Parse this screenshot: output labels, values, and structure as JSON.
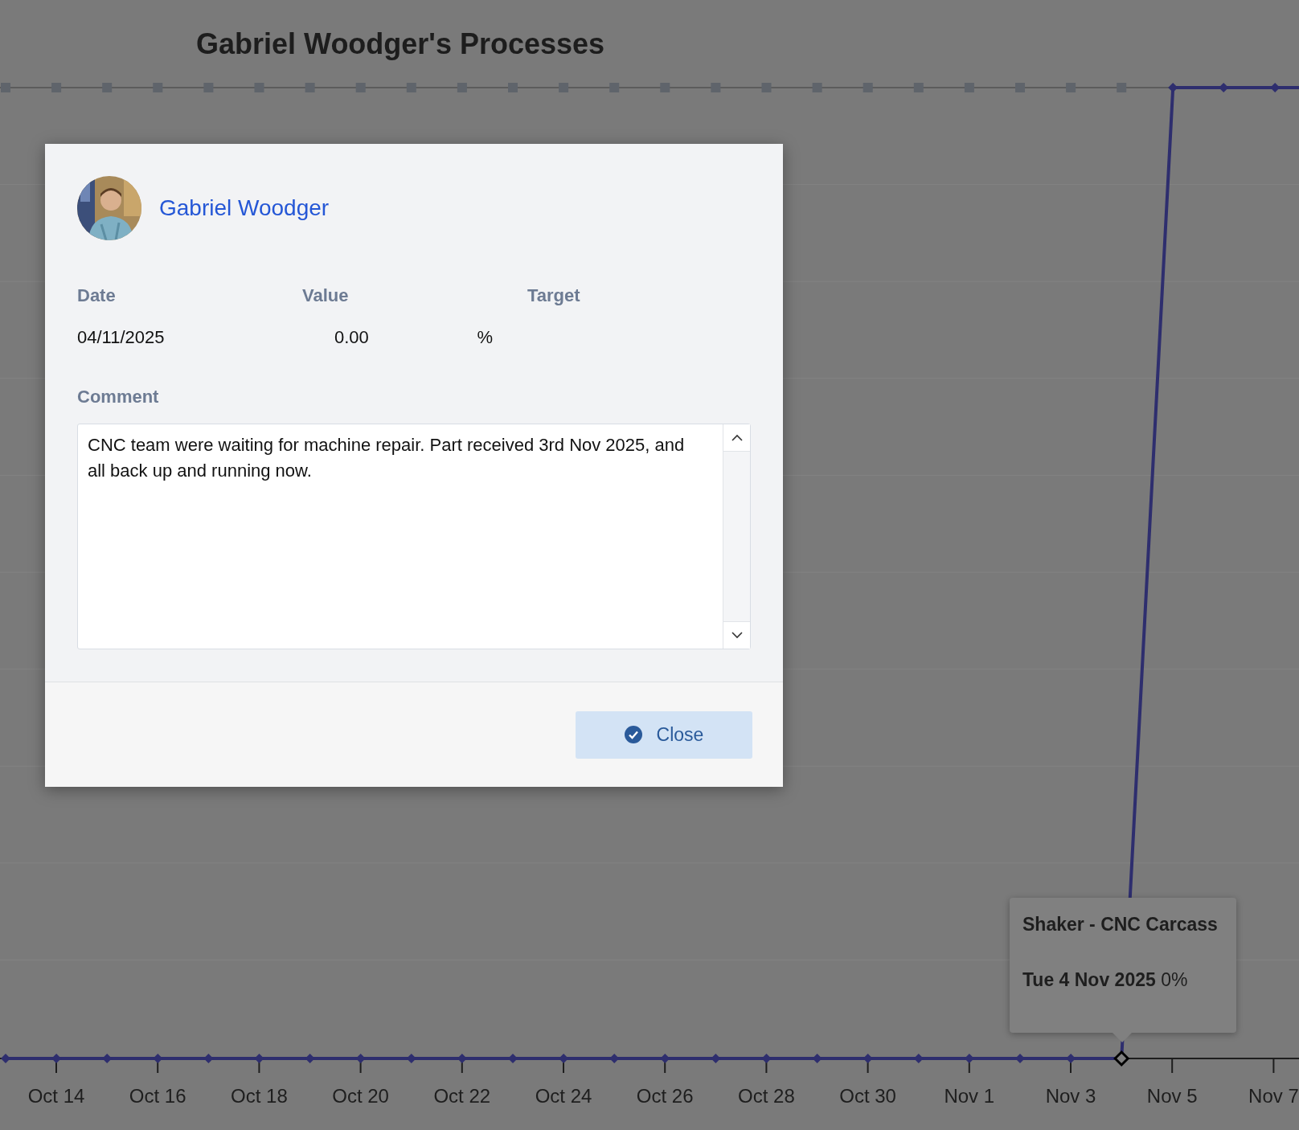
{
  "chart": {
    "title": "Gabriel Woodger's Processes",
    "x_labels": [
      "Oct 14",
      "Oct 16",
      "Oct 18",
      "Oct 20",
      "Oct 22",
      "Oct 24",
      "Oct 26",
      "Oct 28",
      "Oct 30",
      "Nov 1",
      "Nov 3",
      "Nov 5",
      "Nov 7"
    ],
    "tooltip": {
      "series": "Shaker - CNC Carcass",
      "point": "**Tue 4 Nov 2025** 0%"
    }
  },
  "dialog": {
    "user": {
      "name": "Gabriel Woodger"
    },
    "fields": [
      {
        "label": "Date",
        "value": "04/11/2025"
      },
      {
        "label": "Value",
        "value": "0.00",
        "unit": "%"
      },
      {
        "label": "Target"
      }
    ],
    "comment_label": "Comment",
    "comment": "CNC team were waiting for machine repair. Part received 3rd Nov 2025, and all back up and running now.",
    "buttons": [
      {
        "label": "Close"
      }
    ]
  }
}
